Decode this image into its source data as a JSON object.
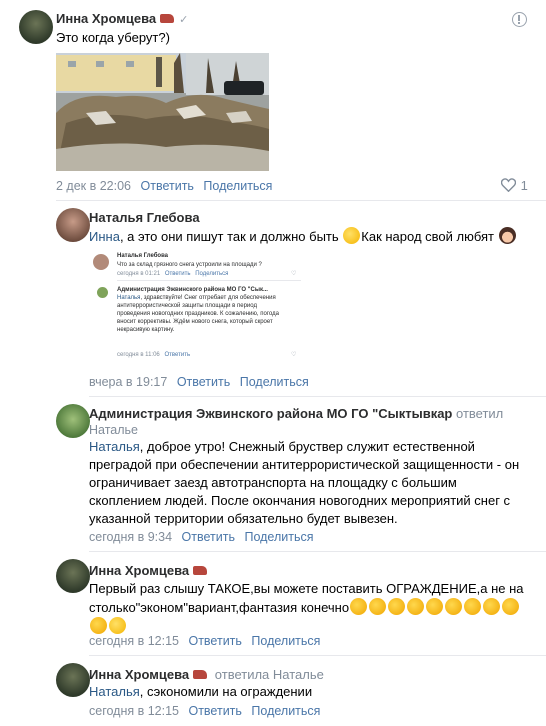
{
  "c1": {
    "author": "Инна Хромцева",
    "text": "Это когда уберут?)",
    "time": "2 дек в 22:06",
    "reply": "Ответить",
    "share": "Поделиться",
    "likes": "1",
    "menu_icon": "more-icon",
    "like_icon": "heart-icon"
  },
  "c2": {
    "author": "Наталья Глебова",
    "mention": "Инна",
    "text_before": ", а это они пишут так и должно быть ",
    "text_after": "Как народ свой любят ",
    "time": "вчера в 19:17",
    "reply": "Ответить",
    "share": "Поделиться",
    "shot": {
      "q_author": "Наталья Глебова",
      "q_text": "Что за  склад грязного снега устроили на площади ?",
      "q_time": "сегодня в 01:21",
      "q_reply": "Ответить",
      "q_share": "Поделиться",
      "a_author": "Администрация Эжвинского района МО ГО \"Сык...",
      "a_mention": "Наталья",
      "a_text": ", здравствуйте! Снег отгребает для обеспечения антитеррористической защиты площади в период проведения новогодних праздников. К сожалению, погода вносит коррективы. Ждём нового снега, который скроет некрасивую картину.",
      "a_time": "сегодня в 11:06",
      "a_reply": "Ответить"
    }
  },
  "c3": {
    "author": "Администрация Эжвинского района МО ГО \"Сыктывкар",
    "reply_note": "ответил",
    "reply_to": "Наталье",
    "mention": "Наталья",
    "text": ", доброе утро! Снежный бруствер служит естественной преградой при обеспечении антитеррористической защищенности - он ограничивает заезд автотранспорта на площадку с большим скоплением людей. После окончания новогодних мероприятий снег с указанной территории обязательно будет вывезен.",
    "time": "сегодня в 9:34",
    "reply": "Ответить",
    "share": "Поделиться"
  },
  "c4": {
    "author": "Инна Хромцева",
    "text": "Первый раз слышу ТАКОЕ,вы можете поставить ОГРАЖДЕНИЕ,а не на столько\"эконом\"вариант,фантазия конечно",
    "time": "сегодня в 12:15",
    "reply": "Ответить",
    "share": "Поделиться"
  },
  "c5": {
    "author": "Инна Хромцева",
    "reply_note": "ответила Наталье",
    "mention": "Наталья",
    "text": ", сэкономили на ограждении",
    "time": "сегодня в 12:15",
    "reply": "Ответить",
    "share": "Поделиться"
  }
}
